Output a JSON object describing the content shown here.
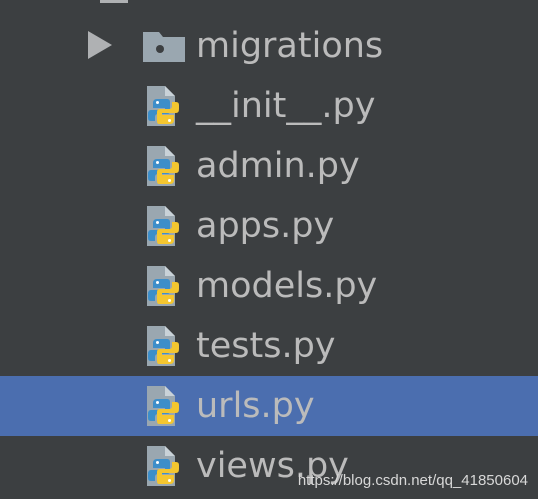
{
  "tree": {
    "folder": {
      "label": "migrations",
      "expanded": false,
      "icon": "folder-icon",
      "arrow_icon": "expand-arrow-icon"
    },
    "files": [
      {
        "label": "__init__.py",
        "icon": "python-file-icon",
        "selected": false
      },
      {
        "label": "admin.py",
        "icon": "python-file-icon",
        "selected": false
      },
      {
        "label": "apps.py",
        "icon": "python-file-icon",
        "selected": false
      },
      {
        "label": "models.py",
        "icon": "python-file-icon",
        "selected": false
      },
      {
        "label": "tests.py",
        "icon": "python-file-icon",
        "selected": false
      },
      {
        "label": "urls.py",
        "icon": "python-file-icon",
        "selected": true
      },
      {
        "label": "views.py",
        "icon": "python-file-icon",
        "selected": false
      }
    ]
  },
  "watermark": "https://blog.csdn.net/qq_41850604",
  "colors": {
    "background": "#3c3f41",
    "selection": "#4b6eaf",
    "text": "#bbbbbb",
    "icon_gray": "#9aa7b0",
    "python_blue": "#3d8ec9",
    "python_yellow": "#f4c62f"
  }
}
